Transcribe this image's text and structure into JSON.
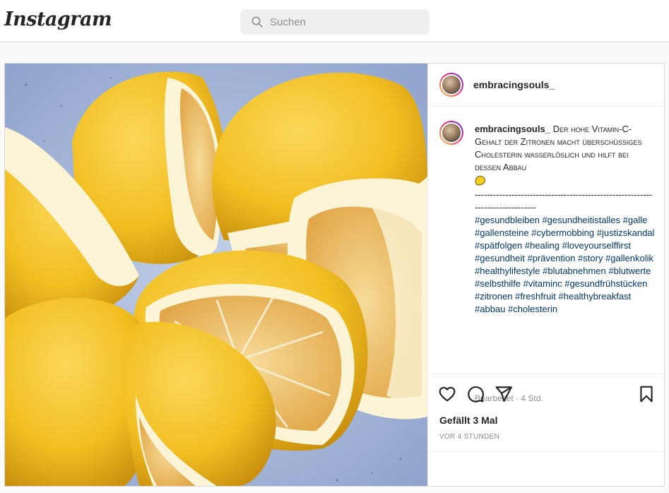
{
  "header": {
    "logo": "Instagram",
    "search_placeholder": "Suchen"
  },
  "post": {
    "username": "embracingsouls_",
    "caption": "Der hohe Vitamin-C-Gehalt der Zitronen macht überschüssiges Cholesterin wasserlöslich und hilft bei dessen Abbau",
    "caption_emoji": "lemon-emoji",
    "divider": "------------------------------------------------------------------------------",
    "hashtags": [
      "#gesundbleiben",
      "#gesundheitistalles",
      "#galle",
      "#gallensteine",
      "#cybermobbing",
      "#justizskandal",
      "#spätfolgen",
      "#healing",
      "#loveyourselffirst",
      "#gesundheit",
      "#prävention",
      "#story",
      "#gallenkolik",
      "#healthylifestyle",
      "#blutabnehmen",
      "#blutwerte",
      "#selbsthilfe",
      "#vitaminc",
      "#gesundfrühstücken",
      "#zitronen",
      "#freshfruit",
      "#healthybreakfast",
      "#abbau",
      "#cholesterin"
    ],
    "edited": "Bearbeitet · 4 Std.",
    "likes": "Gefällt 3 Mal",
    "time": "VOR 4 STUNDEN"
  },
  "icons": {
    "like": "heart-icon",
    "comment": "comment-icon",
    "share": "paper-plane-icon",
    "save": "bookmark-icon",
    "search": "search-icon"
  },
  "colors": {
    "hashtag": "#00376b",
    "border": "#dbdbdb",
    "muted": "#8e8e8e",
    "plate": "#aabbd9",
    "lemon_peel": "#f2bf22",
    "lemon_pith": "#fbf4d6",
    "lemon_flesh": "#efc468"
  }
}
